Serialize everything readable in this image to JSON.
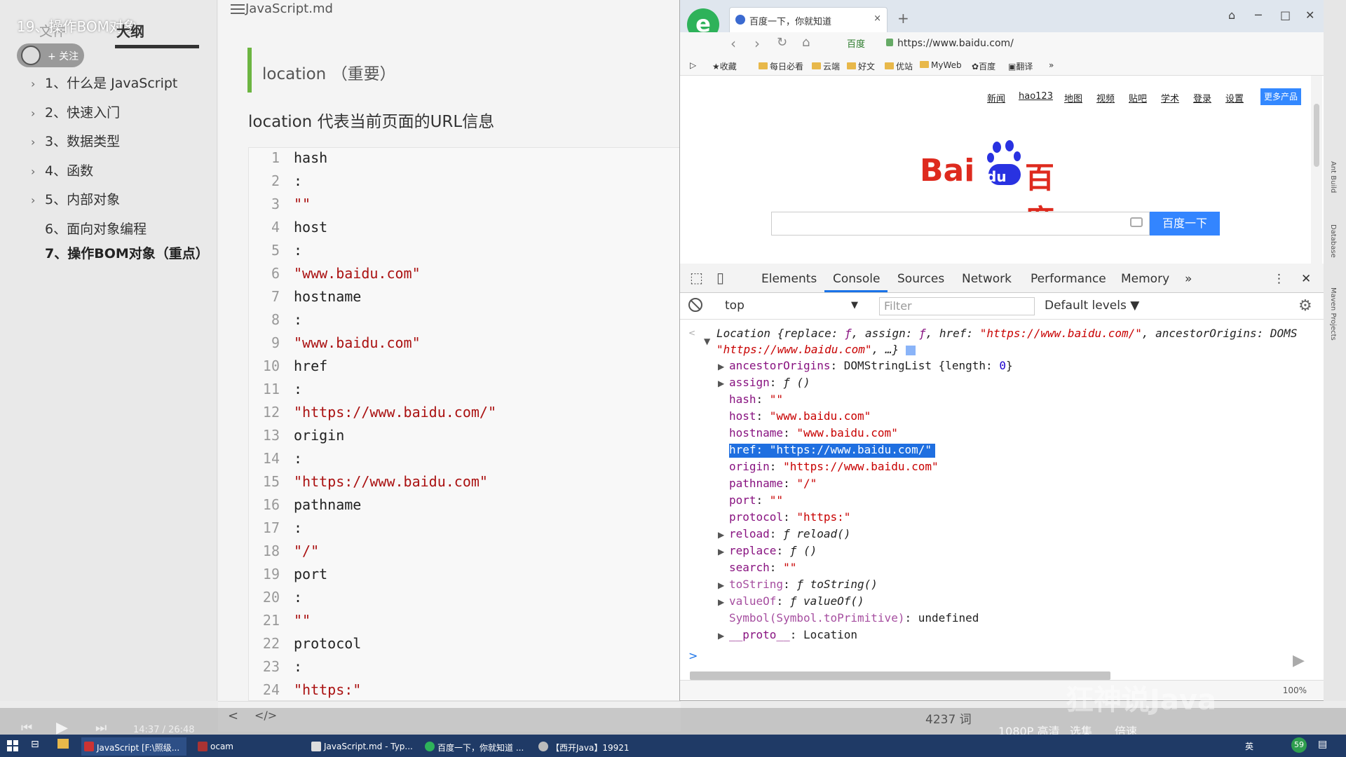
{
  "sidebar": {
    "video_title": "19、操作BOM对象",
    "tab_file": "文件",
    "tab_outline": "大纲",
    "follow_label": "+ 关注",
    "items": [
      {
        "label": "1、什么是 JavaScript"
      },
      {
        "label": "2、快速入门"
      },
      {
        "label": "3、数据类型"
      },
      {
        "label": "4、函数"
      },
      {
        "label": "5、内部对象"
      },
      {
        "label": "6、面向对象编程"
      },
      {
        "label": "7、操作BOM对象（重点）"
      }
    ]
  },
  "editor": {
    "filename": "JavaScript.md",
    "heading": "location  （重要）",
    "description": "location 代表当前页面的URL信息",
    "code_lines": [
      {
        "n": "1",
        "t": "hash",
        "s": false
      },
      {
        "n": "2",
        "t": ":",
        "s": false
      },
      {
        "n": "3",
        "t": "\"\"",
        "s": true
      },
      {
        "n": "4",
        "t": "host",
        "s": false
      },
      {
        "n": "5",
        "t": ":",
        "s": false
      },
      {
        "n": "6",
        "t": "\"www.baidu.com\"",
        "s": true
      },
      {
        "n": "7",
        "t": "hostname",
        "s": false
      },
      {
        "n": "8",
        "t": ":",
        "s": false
      },
      {
        "n": "9",
        "t": "\"www.baidu.com\"",
        "s": true
      },
      {
        "n": "10",
        "t": "href",
        "s": false
      },
      {
        "n": "11",
        "t": ":",
        "s": false
      },
      {
        "n": "12",
        "t": "\"https://www.baidu.com/\"",
        "s": true
      },
      {
        "n": "13",
        "t": "origin",
        "s": false
      },
      {
        "n": "14",
        "t": ":",
        "s": false
      },
      {
        "n": "15",
        "t": "\"https://www.baidu.com\"",
        "s": true
      },
      {
        "n": "16",
        "t": "pathname",
        "s": false
      },
      {
        "n": "17",
        "t": ":",
        "s": false
      },
      {
        "n": "18",
        "t": "\"/\"",
        "s": true
      },
      {
        "n": "19",
        "t": "port",
        "s": false
      },
      {
        "n": "20",
        "t": ":",
        "s": false
      },
      {
        "n": "21",
        "t": "\"\"",
        "s": true
      },
      {
        "n": "22",
        "t": "protocol",
        "s": false
      },
      {
        "n": "23",
        "t": ":",
        "s": false
      },
      {
        "n": "24",
        "t": "\"https:\"",
        "s": true
      }
    ],
    "word_count": "4237 词",
    "nav_prev": "<",
    "nav_code": "</>"
  },
  "browser": {
    "tab_title": "百度一下，你就知道",
    "url": "https://www.baidu.com/",
    "url_badge": "百度",
    "bookmarks": [
      "收藏",
      "每日必看",
      "云端",
      "好文",
      "优站",
      "MyWeb",
      "百度",
      "翻译"
    ],
    "page": {
      "top_links": [
        "新闻",
        "hao123",
        "地图",
        "视频",
        "贴吧",
        "学术",
        "登录",
        "设置"
      ],
      "more_products": "更多产品",
      "logo_bai": "Bai",
      "logo_du": "du",
      "logo_cn": "百度",
      "search_button": "百度一下"
    }
  },
  "devtools": {
    "tabs": [
      "Elements",
      "Console",
      "Sources",
      "Network",
      "Performance",
      "Memory"
    ],
    "more": "»",
    "active_tab": "Console",
    "context": "top",
    "filter_placeholder": "Filter",
    "levels": "Default levels",
    "console": {
      "head1_pre": "Location {replace: ",
      "head1_f": "ƒ",
      "head1_mid": ", assign: ",
      "head1_f2": "ƒ",
      "head1_mid2": ", href: ",
      "head1_href": "\"https://www.baidu.com/\"",
      "head1_tail": ", ancestorOrigins: DOMS",
      "head2_str": "\"https://www.baidu.com\"",
      "head2_tail": ", …}",
      "props": [
        {
          "k": "ancestorOrigins",
          "v": "DOMStringList {length: ",
          "n": "0",
          "e": "}",
          "exp": true
        },
        {
          "k": "assign",
          "v": "ƒ ()",
          "exp": true
        },
        {
          "k": "hash",
          "s": "\"\""
        },
        {
          "k": "host",
          "s": "\"www.baidu.com\""
        },
        {
          "k": "hostname",
          "s": "\"www.baidu.com\""
        },
        {
          "k": "href",
          "s": "\"https://www.baidu.com/\""
        },
        {
          "k": "origin",
          "s": "\"https://www.baidu.com\""
        },
        {
          "k": "pathname",
          "s": "\"/\""
        },
        {
          "k": "port",
          "s": "\"\""
        },
        {
          "k": "protocol",
          "s": "\"https:\""
        },
        {
          "k": "reload",
          "v": "ƒ reload()",
          "exp": true
        },
        {
          "k": "replace",
          "v": "ƒ ()",
          "exp": true
        },
        {
          "k": "search",
          "s": "\"\""
        },
        {
          "k": "toString",
          "v": "ƒ toString()",
          "exp": true
        },
        {
          "k": "valueOf",
          "v": "ƒ valueOf()",
          "exp": true
        },
        {
          "k": "Symbol(Symbol.toPrimitive)",
          "v": "undefined"
        },
        {
          "k": "__proto__",
          "v": "Location",
          "exp": true
        }
      ],
      "prompt": ">"
    },
    "status_zoom": "100%"
  },
  "player": {
    "time": "14:37 / 26:48",
    "quality": "1080P 高清",
    "speed": "选集",
    "rate": "倍速",
    "watermark": "狂神说Java"
  },
  "taskbar": {
    "items": [
      {
        "label": "JavaScript [F:\\照级..."
      },
      {
        "label": "ocam"
      },
      {
        "label": "JavaScript.md - Typ..."
      },
      {
        "label": "百度一下，你就知道 ..."
      },
      {
        "label": "【西开Java】19921"
      }
    ],
    "ime": "英",
    "badge": "59"
  },
  "colors": {
    "accent_green": "#6cb541",
    "string_red": "#c80000",
    "keyword_purple": "#881280",
    "selection_blue": "#1f6fe0",
    "baidu_blue": "#3385ff",
    "baidu_red": "#de2a1e"
  }
}
